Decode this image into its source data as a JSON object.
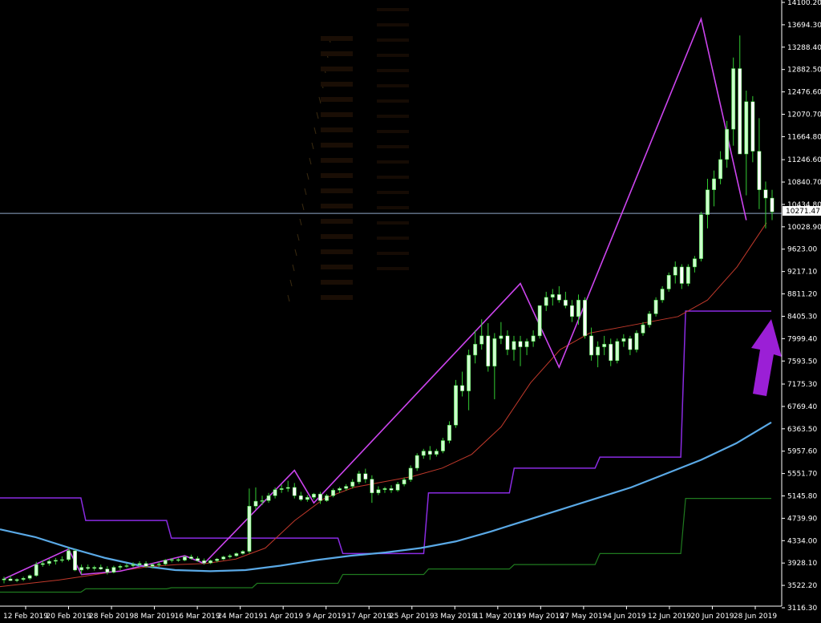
{
  "chart_data": {
    "type": "candlestick",
    "title": "",
    "xlabel": "",
    "ylabel": "",
    "x_tick_labels": [
      "12 Feb 2019",
      "20 Feb 2019",
      "28 Feb 2019",
      "8 Mar 2019",
      "16 Mar 2019",
      "24 Mar 2019",
      "1 Apr 2019",
      "9 Apr 2019",
      "17 Apr 2019",
      "25 Apr 2019",
      "3 May 2019",
      "11 May 2019",
      "19 May 2019",
      "27 May 2019",
      "4 Jun 2019",
      "12 Jun 2019",
      "20 Jun 2019",
      "28 Jun 2019"
    ],
    "y_tick_labels": [
      "14100.20",
      "13694.30",
      "13288.40",
      "12882.50",
      "12476.60",
      "12070.70",
      "11664.80",
      "11246.60",
      "10840.70",
      "10434.80",
      "10028.90",
      "9623.00",
      "9217.10",
      "8811.20",
      "8405.30",
      "7999.40",
      "7593.50",
      "7175.30",
      "6769.40",
      "6363.50",
      "5957.60",
      "5551.70",
      "5145.80",
      "4739.90",
      "4334.00",
      "3928.10",
      "3522.20",
      "3116.30"
    ],
    "ylim": [
      3116.3,
      14100.2
    ],
    "current_price_label": "10271.47",
    "current_price": 10271.47,
    "grid": false,
    "colors": {
      "background": "#000000",
      "bull_candle": "#ccffcc",
      "bear_candle": "#ffffff",
      "wick": "#33cc33",
      "zigzag": "#cc44ee",
      "moving_average_red": "#c0392b",
      "moving_average_blue": "#5aa9e6",
      "channel_upper": "#8a2be2",
      "channel_lower": "#1f7a1f",
      "price_line": "#8fa8c8",
      "arrow": "#9b1fd6"
    },
    "candles": [
      [
        3620,
        3680,
        3560,
        3640
      ],
      [
        3640,
        3700,
        3600,
        3610
      ],
      [
        3610,
        3650,
        3580,
        3630
      ],
      [
        3630,
        3680,
        3600,
        3650
      ],
      [
        3650,
        3720,
        3620,
        3700
      ],
      [
        3700,
        3950,
        3680,
        3900
      ],
      [
        3900,
        3980,
        3860,
        3920
      ],
      [
        3920,
        4000,
        3880,
        3960
      ],
      [
        3960,
        4020,
        3900,
        3980
      ],
      [
        3980,
        4050,
        3940,
        3990
      ],
      [
        3990,
        4200,
        3960,
        4150
      ],
      [
        4150,
        4180,
        3780,
        3800
      ],
      [
        3800,
        3900,
        3720,
        3850
      ],
      [
        3850,
        3900,
        3800,
        3830
      ],
      [
        3830,
        3880,
        3790,
        3850
      ],
      [
        3850,
        3900,
        3800,
        3820
      ],
      [
        3820,
        3870,
        3720,
        3760
      ],
      [
        3760,
        3880,
        3740,
        3850
      ],
      [
        3850,
        3900,
        3800,
        3870
      ],
      [
        3870,
        3920,
        3840,
        3880
      ],
      [
        3880,
        3940,
        3850,
        3900
      ],
      [
        3900,
        3960,
        3860,
        3920
      ],
      [
        3920,
        3960,
        3840,
        3870
      ],
      [
        3870,
        3920,
        3830,
        3900
      ],
      [
        3900,
        3950,
        3860,
        3910
      ],
      [
        3910,
        4000,
        3880,
        3980
      ],
      [
        3980,
        4020,
        3940,
        3990
      ],
      [
        3990,
        4020,
        3950,
        3980
      ],
      [
        3980,
        4060,
        3960,
        4040
      ],
      [
        4040,
        4080,
        3990,
        4010
      ],
      [
        4010,
        4050,
        3950,
        3970
      ],
      [
        3970,
        4010,
        3900,
        3930
      ],
      [
        3930,
        3990,
        3910,
        3970
      ],
      [
        3970,
        4020,
        3940,
        4000
      ],
      [
        4000,
        4060,
        3980,
        4040
      ],
      [
        4040,
        4090,
        4010,
        4060
      ],
      [
        4060,
        4120,
        4040,
        4100
      ],
      [
        4100,
        4160,
        4080,
        4140
      ],
      [
        4140,
        5280,
        4100,
        4960
      ],
      [
        4960,
        5300,
        4900,
        5050
      ],
      [
        5050,
        5150,
        4980,
        5060
      ],
      [
        5060,
        5200,
        5020,
        5150
      ],
      [
        5150,
        5300,
        5100,
        5260
      ],
      [
        5260,
        5350,
        5200,
        5280
      ],
      [
        5280,
        5420,
        5220,
        5300
      ],
      [
        5300,
        5380,
        5100,
        5150
      ],
      [
        5150,
        5220,
        5050,
        5080
      ],
      [
        5080,
        5160,
        5040,
        5120
      ],
      [
        5120,
        5200,
        5080,
        5180
      ],
      [
        5180,
        5220,
        5000,
        5060
      ],
      [
        5060,
        5180,
        5040,
        5150
      ],
      [
        5150,
        5280,
        5120,
        5250
      ],
      [
        5250,
        5310,
        5200,
        5280
      ],
      [
        5280,
        5360,
        5240,
        5320
      ],
      [
        5320,
        5450,
        5280,
        5400
      ],
      [
        5400,
        5600,
        5360,
        5550
      ],
      [
        5550,
        5640,
        5380,
        5450
      ],
      [
        5450,
        5520,
        5020,
        5200
      ],
      [
        5200,
        5320,
        5160,
        5260
      ],
      [
        5260,
        5310,
        5200,
        5280
      ],
      [
        5280,
        5340,
        5200,
        5250
      ],
      [
        5250,
        5400,
        5220,
        5360
      ],
      [
        5360,
        5480,
        5320,
        5440
      ],
      [
        5440,
        5700,
        5400,
        5650
      ],
      [
        5650,
        5920,
        5600,
        5880
      ],
      [
        5880,
        6000,
        5820,
        5960
      ],
      [
        5960,
        6050,
        5800,
        5900
      ],
      [
        5900,
        6000,
        5860,
        5960
      ],
      [
        5960,
        6200,
        5920,
        6150
      ],
      [
        6150,
        6500,
        6100,
        6430
      ],
      [
        6430,
        7250,
        6380,
        7150
      ],
      [
        7150,
        7400,
        6950,
        7050
      ],
      [
        7050,
        7800,
        6700,
        7700
      ],
      [
        7700,
        8150,
        7550,
        7900
      ],
      [
        7900,
        8350,
        7800,
        8050
      ],
      [
        8050,
        8280,
        7400,
        7500
      ],
      [
        7500,
        8100,
        6900,
        8000
      ],
      [
        8000,
        8300,
        7900,
        8050
      ],
      [
        8050,
        8150,
        7700,
        7800
      ],
      [
        7800,
        8050,
        7600,
        7950
      ],
      [
        7950,
        8050,
        7500,
        7850
      ],
      [
        7850,
        8000,
        7700,
        7950
      ],
      [
        7950,
        8150,
        7850,
        8050
      ],
      [
        8050,
        8450,
        8000,
        8600
      ],
      [
        8600,
        8850,
        8500,
        8750
      ],
      [
        8750,
        8900,
        8600,
        8800
      ],
      [
        8800,
        8950,
        8650,
        8700
      ],
      [
        8700,
        8850,
        8550,
        8600
      ],
      [
        8600,
        8700,
        8300,
        8400
      ],
      [
        8400,
        8800,
        8250,
        8700
      ],
      [
        8700,
        8750,
        8000,
        8050
      ],
      [
        8050,
        8200,
        7600,
        7700
      ],
      [
        7700,
        7950,
        7480,
        7850
      ],
      [
        7850,
        8050,
        7700,
        7900
      ],
      [
        7900,
        8000,
        7500,
        7600
      ],
      [
        7600,
        8000,
        7550,
        7950
      ],
      [
        7950,
        8080,
        7850,
        8000
      ],
      [
        8000,
        8050,
        7700,
        7800
      ],
      [
        7800,
        8150,
        7750,
        8100
      ],
      [
        8100,
        8300,
        8050,
        8250
      ],
      [
        8250,
        8500,
        8200,
        8450
      ],
      [
        8450,
        8750,
        8400,
        8700
      ],
      [
        8700,
        8950,
        8650,
        8900
      ],
      [
        8900,
        9200,
        8850,
        9150
      ],
      [
        9150,
        9400,
        9000,
        9300
      ],
      [
        9300,
        9350,
        8900,
        9000
      ],
      [
        9000,
        9350,
        8950,
        9300
      ],
      [
        9300,
        9500,
        9200,
        9450
      ],
      [
        9450,
        10300,
        9400,
        10250
      ],
      [
        10250,
        10900,
        10000,
        10700
      ],
      [
        10700,
        11050,
        10400,
        10900
      ],
      [
        10900,
        11400,
        10800,
        11250
      ],
      [
        11250,
        11950,
        11100,
        11800
      ],
      [
        11800,
        13100,
        11500,
        12900
      ],
      [
        12900,
        13500,
        12100,
        11350
      ],
      [
        11350,
        12500,
        10600,
        12300
      ],
      [
        12300,
        12400,
        11200,
        11400
      ],
      [
        11400,
        12000,
        10350,
        10700
      ],
      [
        10700,
        10850,
        10000,
        10550
      ],
      [
        10550,
        10700,
        10150,
        10300
      ]
    ],
    "zigzag_values": [
      3640,
      4180,
      3720,
      3780,
      4060,
      3920,
      5610,
      5020,
      9000,
      7480,
      13800,
      10150
    ],
    "red_ma_values": [
      3500,
      3560,
      3620,
      3700,
      3780,
      3860,
      3900,
      3920,
      4000,
      4200,
      4700,
      5100,
      5300,
      5400,
      5500,
      5650,
      5900,
      6400,
      7200,
      7800,
      8100,
      8200,
      8300,
      8400,
      8700,
      9300,
      10100
    ],
    "blue_ma_values": [
      4540,
      4400,
      4200,
      4020,
      3880,
      3800,
      3780,
      3800,
      3880,
      3980,
      4060,
      4120,
      4200,
      4320,
      4500,
      4700,
      4900,
      5100,
      5300,
      5550,
      5800,
      6100,
      6480
    ],
    "channel_upper_values": [
      5110,
      4700,
      4380,
      4380,
      4100,
      5200,
      5650,
      5850,
      8500,
      8500
    ],
    "channel_lower_values": [
      3400,
      3460,
      3480,
      3560,
      3720,
      3820,
      3900,
      4100,
      5100,
      5100
    ]
  }
}
